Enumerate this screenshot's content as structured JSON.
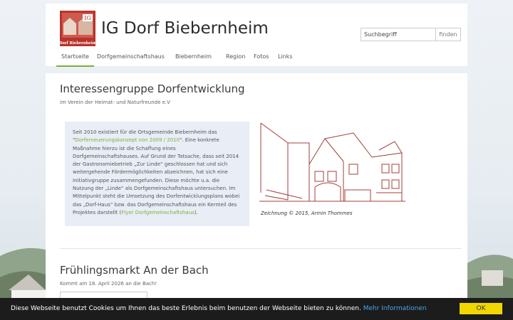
{
  "site": {
    "title": "IG Dorf Biebernheim",
    "logo_text": "Dorf Biebernheim",
    "logo_initials": "IG"
  },
  "search": {
    "placeholder": "Suchbegriff",
    "button_label": "finden"
  },
  "nav": {
    "items": [
      {
        "label": "Startseite",
        "active": true
      },
      {
        "label": "Dorfgemeinschaftshaus"
      },
      {
        "label": "Biebernheim"
      },
      {
        "label": "Region"
      },
      {
        "label": "Fotos"
      },
      {
        "label": "Links"
      }
    ]
  },
  "intro": {
    "heading": "Interessengruppe Dorfentwicklung",
    "subheading": "im Verein der Heimat- und Naturfreunde e.V",
    "text_1": "Seit 2010 existiert für die Ortsgemeinde Biebernheim das \"",
    "link_1": "Dorferneuerungskonzept von 2009 / 2010",
    "text_2": "\". Eine konkrete Maßnahme hierzu ist die Schaffung eines Dorfgemeinschaftshauses. Auf Grund der Tatsache, dass seit 2014 der Gastronomiebetrieb „Zur Linde“ geschlossen hat und sich weitergehende Fördermöglichkeiten abzeichnen, hat sich eine Initiativgruppe zusammengefunden. Diese möchte u.a. die Nutzung der „Linde“ als Dorfgemeinschaftshaus untersuchen. Im Mittelpunkt steht die Umsetzung des Dorfentwicklungsplans wobei das „Dorf-Haus“ bzw. das Dorfgemeinschaftshaus ein Kernteil des Projektes darstellt (",
    "link_2": "Flyer Dorfgemeinschaftshaus",
    "text_3": ")."
  },
  "drawing": {
    "caption": "Zeichnung © 2015, Armin Thommes"
  },
  "post": {
    "title": "Frühlingsmarkt An der Bach",
    "meta": "Kommt am 18. April 2026 an die Bach!"
  },
  "cookie": {
    "text": "Diese Webseite benutzt Cookies um Ihnen das beste Erlebnis beim benutzen der Webseite bieten zu können.",
    "link": "Mehr Informationen",
    "button": "OK"
  },
  "colors": {
    "accent_green": "#7fae3a",
    "logo_red": "#b8342b",
    "cookie_bg": "#1c1c1c",
    "cookie_button": "#f1d600",
    "cookie_link": "#49a8ea"
  }
}
